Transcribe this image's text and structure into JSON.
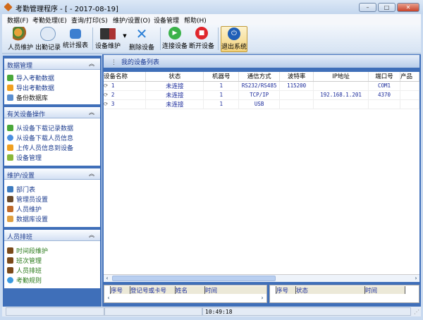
{
  "window": {
    "title": "考勤管理程序 - [ - 2017-08-19]",
    "minimize": "–",
    "maximize": "□",
    "close": "✕"
  },
  "menu": [
    "数据(F)",
    "考勤处理(E)",
    "查询/打印(S)",
    "维护/设置(O)",
    "设备管理",
    "帮助(H)"
  ],
  "toolbar": [
    {
      "label": "人员维护",
      "icon": "people-icon"
    },
    {
      "label": "出勤记录",
      "icon": "clock-document-icon"
    },
    {
      "label": "统计报表",
      "icon": "folder-report-icon"
    },
    {
      "label": "设备维护",
      "icon": "device-icon"
    },
    {
      "label": "删除设备",
      "icon": "delete-x-icon"
    },
    {
      "label": "连接设备",
      "icon": "play-icon"
    },
    {
      "label": "断开设备",
      "icon": "stop-icon"
    },
    {
      "label": "退出系统",
      "icon": "power-icon"
    }
  ],
  "sidebar": {
    "sections": [
      {
        "title": "数据管理",
        "items": [
          "导入考勤数据",
          "导出考勤数据",
          "备份数据库"
        ]
      },
      {
        "title": "有关设备操作",
        "items": [
          "从设备下载记录数据",
          "从设备下载人员信息",
          "上传人员信息到设备",
          "设备管理"
        ]
      },
      {
        "title": "维护/设置",
        "items": [
          "部门表",
          "管理员设置",
          "人员维护",
          "数据库设置"
        ]
      },
      {
        "title": "人员排班",
        "items": [
          "时间段维护",
          "班次管理",
          "人员排班",
          "考勤规则"
        ]
      }
    ]
  },
  "panel": {
    "title": "我的设备列表"
  },
  "devices": {
    "columns": [
      "设备名称",
      "状态",
      "机器号",
      "通信方式",
      "波特率",
      "IP地址",
      "端口号",
      "产品"
    ],
    "rows": [
      [
        "1",
        "未连接",
        "1",
        "RS232/RS485",
        "115200",
        "",
        "COM1",
        ""
      ],
      [
        "2",
        "未连接",
        "1",
        "TCP/IP",
        "",
        "192.168.1.201",
        "4370",
        ""
      ],
      [
        "3",
        "未连接",
        "1",
        "USB",
        "",
        "",
        "",
        ""
      ]
    ]
  },
  "bottom_left": {
    "columns": [
      "序号",
      "登记号或卡号",
      "姓名",
      "时间"
    ]
  },
  "bottom_right": {
    "columns": [
      "序号",
      "状态",
      "时间"
    ]
  },
  "status": {
    "time": "10:49:18"
  }
}
